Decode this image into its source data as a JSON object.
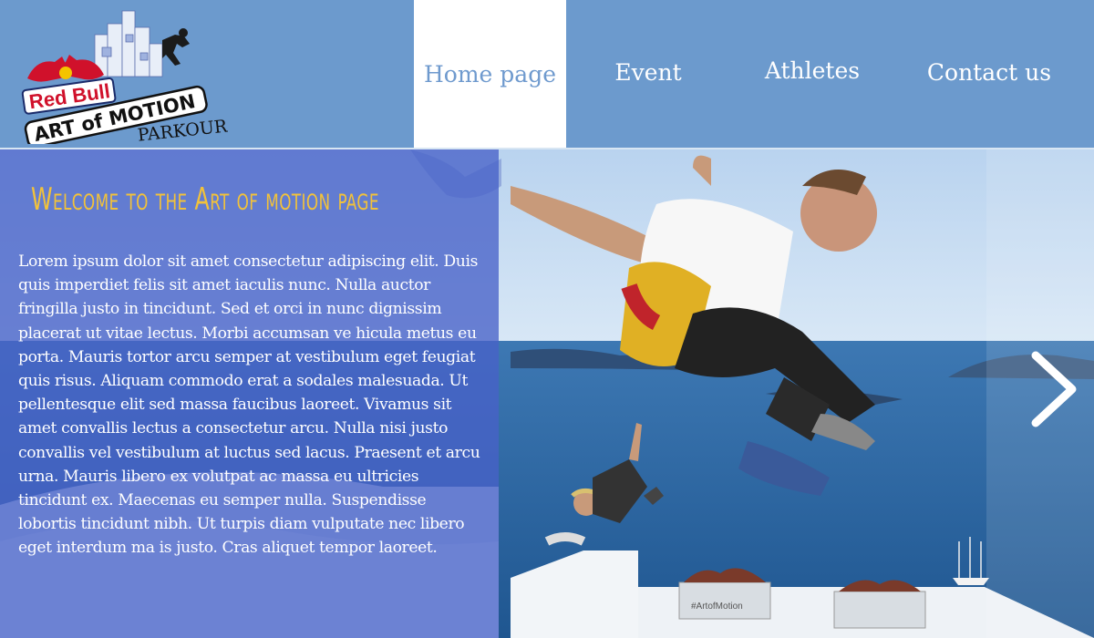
{
  "logo": {
    "brand": "Red Bull",
    "event": "Art of Motion",
    "sub": "PARKOUR"
  },
  "nav": {
    "items": [
      {
        "label": "Home page",
        "active": true
      },
      {
        "label": "Event",
        "active": false
      },
      {
        "label": "Athletes",
        "active": false
      },
      {
        "label": "Contact us",
        "active": false
      }
    ]
  },
  "hero": {
    "title": "Welcome to the Art of motion page",
    "body": "Lorem ipsum dolor sit amet  consectetur adipiscing elit. Duis quis imperdiet felis  sit amet iaculis nunc. Nulla auctor fringilla justo in tincidunt. Sed et orci in nunc dignissim placerat ut vitae lectus. Morbi accumsan ve hicula metus eu porta. Mauris tortor arcu  semper at vestibulum eget  feugiat quis risus. Aliquam commodo erat a sodales malesuada. Ut pellentesque elit sed massa faucibus laoreet. Vivamus sit amet convallis lectus  a consectetur arcu. Nulla nisi justo  convallis vel vestibulum at  luctus sed lacus. Praesent et arcu urna. Mauris libero ex  volutpat ac massa eu  ultricies tincidunt ex. Maecenas eu semper nulla. Suspendisse lobortis tincidunt nibh. Ut turpis diam  vulputate nec libero eget interdum ma  is justo. Cras aliquet tempor laoreet.",
    "planter_tag": "#ArtofMotion",
    "next_icon": "chevron-right-icon"
  },
  "colors": {
    "header_bg": "#6c9acd",
    "active_tab_text": "#6f9ace",
    "title_yellow": "#f2c23a",
    "overlay_blue": "#4862c8"
  }
}
